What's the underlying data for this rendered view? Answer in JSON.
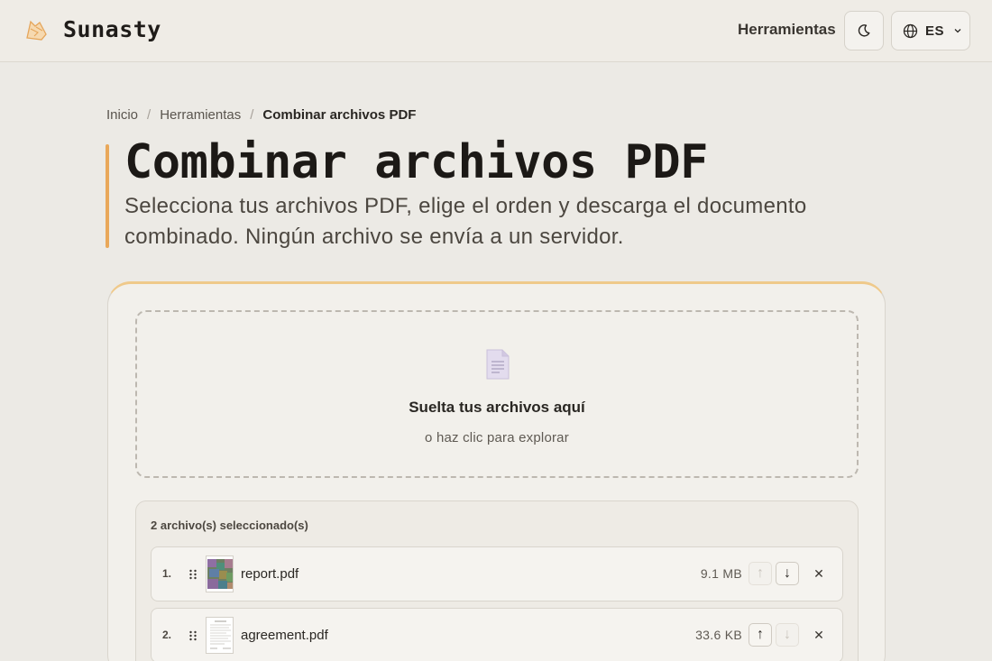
{
  "header": {
    "brand": "Sunasty",
    "nav_tools": "Herramientas",
    "lang_code": "ES"
  },
  "breadcrumb": {
    "items": [
      "Inicio",
      "Herramientas",
      "Combinar archivos PDF"
    ],
    "separator": "/"
  },
  "page": {
    "title": "Combinar archivos PDF",
    "description": "Selecciona tus archivos PDF, elige el orden y descarga el documento combinado. Ningún archivo se envía a un servidor."
  },
  "dropzone": {
    "title": "Suelta tus archivos aquí",
    "subtitle": "o haz clic para explorar"
  },
  "files": {
    "count_label": "2 archivo(s) seleccionado(s)",
    "items": [
      {
        "index": "1.",
        "name": "report.pdf",
        "size": "9.1 MB",
        "up_label": "↑",
        "down_label": "↓",
        "remove_label": "✕"
      },
      {
        "index": "2.",
        "name": "agreement.pdf",
        "size": "33.6 KB",
        "up_label": "↑",
        "down_label": "↓",
        "remove_label": "✕"
      }
    ]
  },
  "colors": {
    "accent": "#e9a85a",
    "background": "#eceae5",
    "card": "#f2f0eb"
  }
}
